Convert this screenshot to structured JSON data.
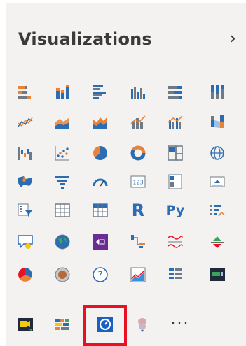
{
  "pane": {
    "title": "Visualizations",
    "collapse_icon": "chevron-right-icon",
    "collapse_glyph": "›"
  },
  "colors": {
    "accent_blue": "#2b6cb3",
    "accent_orange": "#e8833a",
    "accent_gray": "#6f7a84",
    "selection_red": "#e81123",
    "purple": "#6b2d91",
    "teal_dark": "#1f2a3a"
  },
  "visuals": [
    {
      "name": "stacked-bar-chart-icon"
    },
    {
      "name": "stacked-column-chart-icon"
    },
    {
      "name": "clustered-bar-chart-icon"
    },
    {
      "name": "clustered-column-chart-icon"
    },
    {
      "name": "100-stacked-bar-chart-icon"
    },
    {
      "name": "100-stacked-column-chart-icon"
    },
    {
      "name": "line-chart-icon"
    },
    {
      "name": "area-chart-icon"
    },
    {
      "name": "stacked-area-chart-icon"
    },
    {
      "name": "line-and-stacked-column-chart-icon"
    },
    {
      "name": "line-and-clustered-column-chart-icon"
    },
    {
      "name": "ribbon-chart-icon"
    },
    {
      "name": "waterfall-chart-icon"
    },
    {
      "name": "scatter-chart-icon"
    },
    {
      "name": "pie-chart-icon"
    },
    {
      "name": "donut-chart-icon"
    },
    {
      "name": "treemap-icon"
    },
    {
      "name": "map-icon"
    },
    {
      "name": "filled-map-icon"
    },
    {
      "name": "funnel-icon"
    },
    {
      "name": "gauge-icon"
    },
    {
      "name": "card-icon",
      "text": "123"
    },
    {
      "name": "multi-row-card-icon"
    },
    {
      "name": "kpi-icon"
    },
    {
      "name": "slicer-icon"
    },
    {
      "name": "table-icon"
    },
    {
      "name": "matrix-icon"
    },
    {
      "name": "r-script-visual-icon",
      "text": "R"
    },
    {
      "name": "python-visual-icon",
      "text": "Py"
    },
    {
      "name": "key-influencers-icon"
    },
    {
      "name": "qna-icon"
    },
    {
      "name": "globe-map-icon"
    },
    {
      "name": "power-apps-icon"
    },
    {
      "name": "decomposition-tree-icon"
    },
    {
      "name": "smart-narrative-icon"
    },
    {
      "name": "paginated-report-icon"
    },
    {
      "name": "arcgis-map-icon"
    },
    {
      "name": "shape-map-icon"
    },
    {
      "name": "question-icon",
      "text": "?"
    },
    {
      "name": "kpi-line-icon"
    },
    {
      "name": "sort-list-icon"
    },
    {
      "name": "custom-visual-dark-icon"
    },
    {
      "name": "video-visual-icon"
    },
    {
      "name": "column-matrix-icon"
    },
    {
      "name": "selected-custom-visual-icon"
    },
    {
      "name": "brain-icon"
    },
    {
      "name": "more-visuals-icon",
      "text": "···"
    }
  ]
}
